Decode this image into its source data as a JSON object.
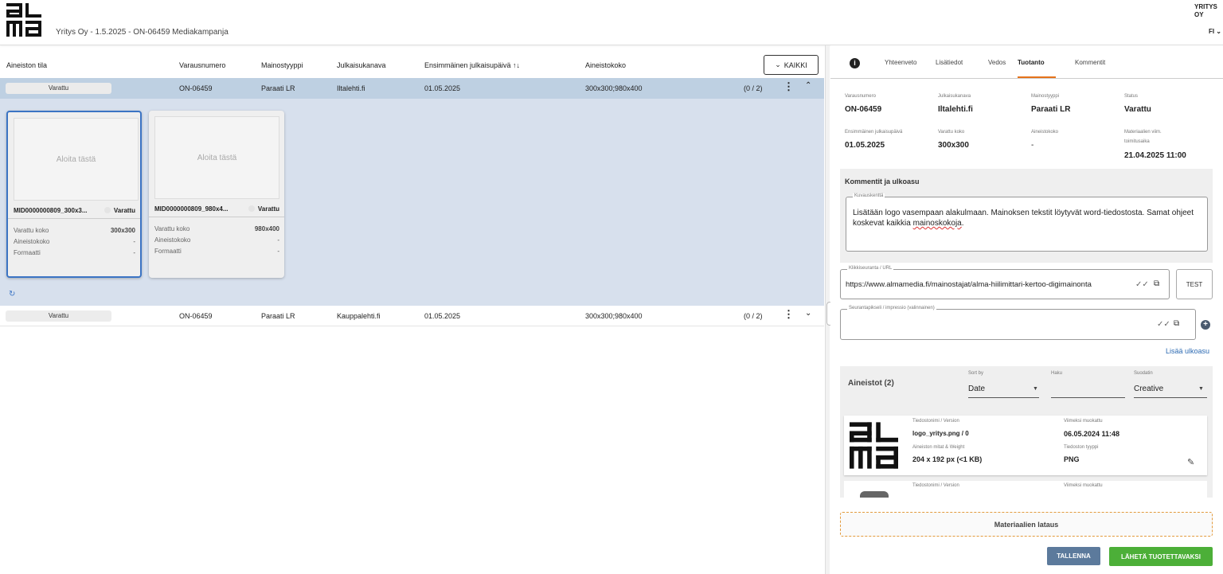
{
  "header": {
    "logo_text": "alma",
    "title": "Yritys Oy - 1.5.2025 - ON-06459 Mediakampanja",
    "company": "YRITYS OY",
    "language": "FI"
  },
  "table": {
    "columns": [
      "Aineiston tila",
      "Varausnumero",
      "Mainostyyppi",
      "Julkaisukanava",
      "Ensimmäinen julkaisupäivä ↑↓",
      "Aineistokoko"
    ],
    "filter_button": "KAIKKI",
    "rows": [
      {
        "status": "Varattu",
        "booking": "ON-06459",
        "ad_type": "Paraati LR",
        "channel": "Iltalehti.fi",
        "first_date": "01.05.2025",
        "size": "300x300;980x400",
        "count": "(0 / 2)"
      },
      {
        "status": "Varattu",
        "booking": "ON-06459",
        "ad_type": "Paraati LR",
        "channel": "Kauppalehti.fi",
        "first_date": "01.05.2025",
        "size": "300x300;980x400",
        "count": "(0 / 2)"
      }
    ],
    "cards": [
      {
        "placeholder": "Aloita tästä",
        "name": "MID0000000809_300x3...",
        "status": "Varattu",
        "reserved_label": "Varattu koko",
        "reserved_value": "300x300",
        "size_label": "Aineistokoko",
        "size_value": "-",
        "format_label": "Formaatti",
        "format_value": "-"
      },
      {
        "placeholder": "Aloita tästä",
        "name": "MID0000000809_980x4...",
        "status": "Varattu",
        "reserved_label": "Varattu koko",
        "reserved_value": "980x400",
        "size_label": "Aineistokoko",
        "size_value": "-",
        "format_label": "Formaatti",
        "format_value": "-"
      }
    ]
  },
  "panel": {
    "tabs": [
      "Yhteenveto",
      "Lisätiedot",
      "Vedos",
      "Tuotanto",
      "Kommentit"
    ],
    "fields": {
      "booking_label": "Varausnumero",
      "booking": "ON-06459",
      "channel_label": "Julkaisukanava",
      "channel": "Iltalehti.fi",
      "adtype_label": "Mainostyyppi",
      "adtype": "Paraati LR",
      "status_label": "Status",
      "status": "Varattu",
      "firstdate_label": "Ensimmäinen julkaisupäivä",
      "firstdate": "01.05.2025",
      "reserved_label": "Varattu koko",
      "reserved": "300x300",
      "size_label": "Aineistokoko",
      "size": "-",
      "deadline_label_1": "Materiaalien viim.",
      "deadline_label_2": "toimitusaika",
      "deadline": "21.04.2025 11:00"
    },
    "comments": {
      "title": "Kommentit ja ulkoasu",
      "desc_legend": "Kuvauskenttä",
      "desc_text_1": "Lisätään logo vasempaan alakulmaan. Mainoksen tekstit löytyvät word-tiedostosta. Samat ohjeet koskevat kaikkia ",
      "desc_text_2": "mainoskokoja",
      "desc_text_3": "."
    },
    "click_legend": "Klikkiseuranta / URL",
    "click_url": "https://www.almamedia.fi/mainostajat/alma-hiilimittari-kertoo-digimainonta",
    "test_button": "TEST",
    "pixel_legend": "Seurantapikseli / impressio (valinnainen)",
    "add_layout_link": "Lisää ulkoasu",
    "assets": {
      "title": "Aineistot (2)",
      "sort_label": "Sort by",
      "sort_value": "Date",
      "search_label": "Haku",
      "filter_label": "Suodatin",
      "filter_value": "Creative",
      "items": [
        {
          "file_label": "Tiedostonimi / Version",
          "file": "logo_yritys.png / 0",
          "modified_label": "Viimeksi muokattu",
          "modified": "06.05.2024 11:48",
          "dims_label": "Aineiston mitat & Weight",
          "dims": "204 x 192 px (<1 KB)",
          "type_label": "Tiedoston tyyppi",
          "type": "PNG"
        },
        {
          "file_label": "Tiedostonimi / Version",
          "modified_label": "Viimeksi muokattu"
        }
      ]
    },
    "upload_label": "Materiaalien lataus",
    "save_button": "TALLENNA",
    "send_button": "LÄHETÄ TUOTETTAVAKSI"
  }
}
